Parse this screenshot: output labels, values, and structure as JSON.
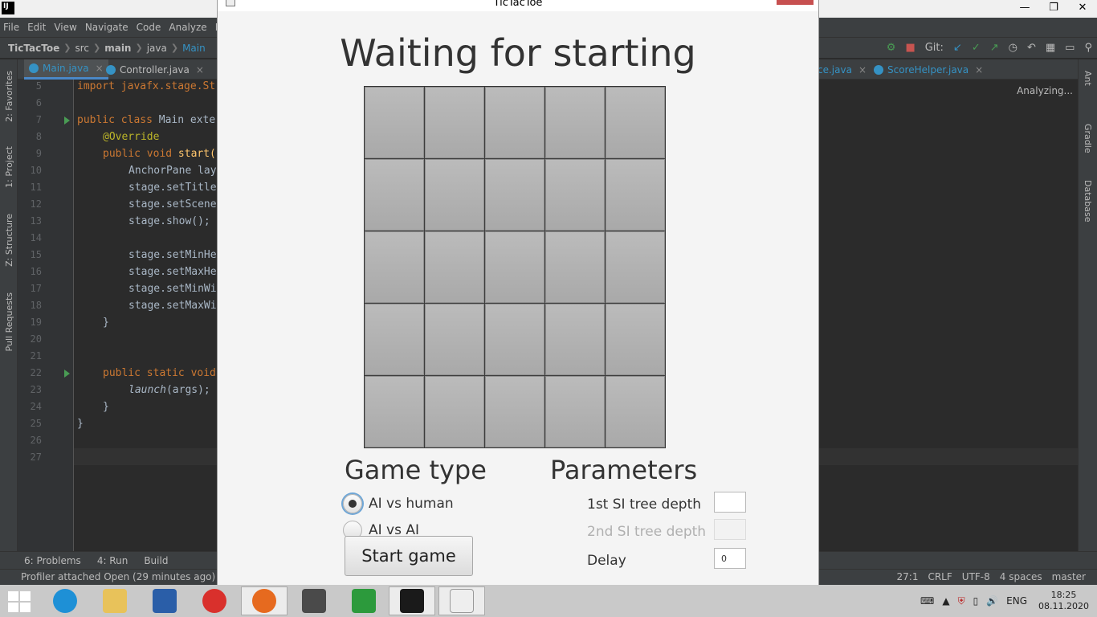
{
  "ide": {
    "menu": [
      "File",
      "Edit",
      "View",
      "Navigate",
      "Code",
      "Analyze",
      "Re"
    ],
    "breadcrumb": [
      "TicTacToe",
      "src",
      "main",
      "java",
      "Main"
    ],
    "tabs": [
      "Main.java",
      "Controller.java",
      "ce.java",
      "ScoreHelper.java"
    ],
    "git_label": "Git:",
    "analyzing": "Analyzing...",
    "left_tools": [
      "2: Favorites",
      "1: Project",
      "Z: Structure",
      "Pull Requests"
    ],
    "right_tools": [
      "Ant",
      "Gradle",
      "Database"
    ],
    "line_numbers": [
      "5",
      "6",
      "7",
      "8",
      "9",
      "10",
      "11",
      "12",
      "13",
      "14",
      "15",
      "16",
      "17",
      "18",
      "19",
      "20",
      "21",
      "22",
      "23",
      "24",
      "25",
      "26",
      "27"
    ],
    "code": {
      "l5": "import javafx.stage.St",
      "l7a": "public class",
      "l7b": " Main exte",
      "l8": "@Override",
      "l9a": "public void",
      "l9b": " start(",
      "l10": "AnchorPane lay",
      "l11": "stage.setTitle",
      "l12": "stage.setScene",
      "l13": "stage.show();",
      "l15": "stage.setMinHe",
      "l16": "stage.setMaxHe",
      "l17": "stage.setMinWi",
      "l18": "stage.setMaxWi",
      "l19": "}",
      "l22a": "public static void",
      "l23a": "launch",
      "l23b": "(args);",
      "l24": "}",
      "l25": "}"
    },
    "bottom_tools": [
      "6: Problems",
      "4: Run",
      "Build"
    ],
    "status_left": "Profiler attached Open (29 minutes ago)",
    "status_right": [
      "27:1",
      "CRLF",
      "UTF-8",
      "4 spaces",
      "master"
    ]
  },
  "app": {
    "title": "TicTacToe",
    "status": "Waiting for starting",
    "board": {
      "rows": 5,
      "cols": 5
    },
    "game_type": {
      "title": "Game type",
      "options": [
        "AI vs human",
        "AI vs AI"
      ],
      "selected": "AI vs human"
    },
    "start_button": "Start game",
    "parameters": {
      "title": "Parameters",
      "tree_depth_1_label": "1st SI tree depth",
      "tree_depth_1_value": "",
      "tree_depth_2_label": "2nd SI tree depth",
      "tree_depth_2_value": "",
      "delay_label": "Delay",
      "delay_value": "0"
    }
  },
  "taskbar": {
    "lang": "ENG",
    "time": "18:25",
    "date": "08.11.2020"
  }
}
